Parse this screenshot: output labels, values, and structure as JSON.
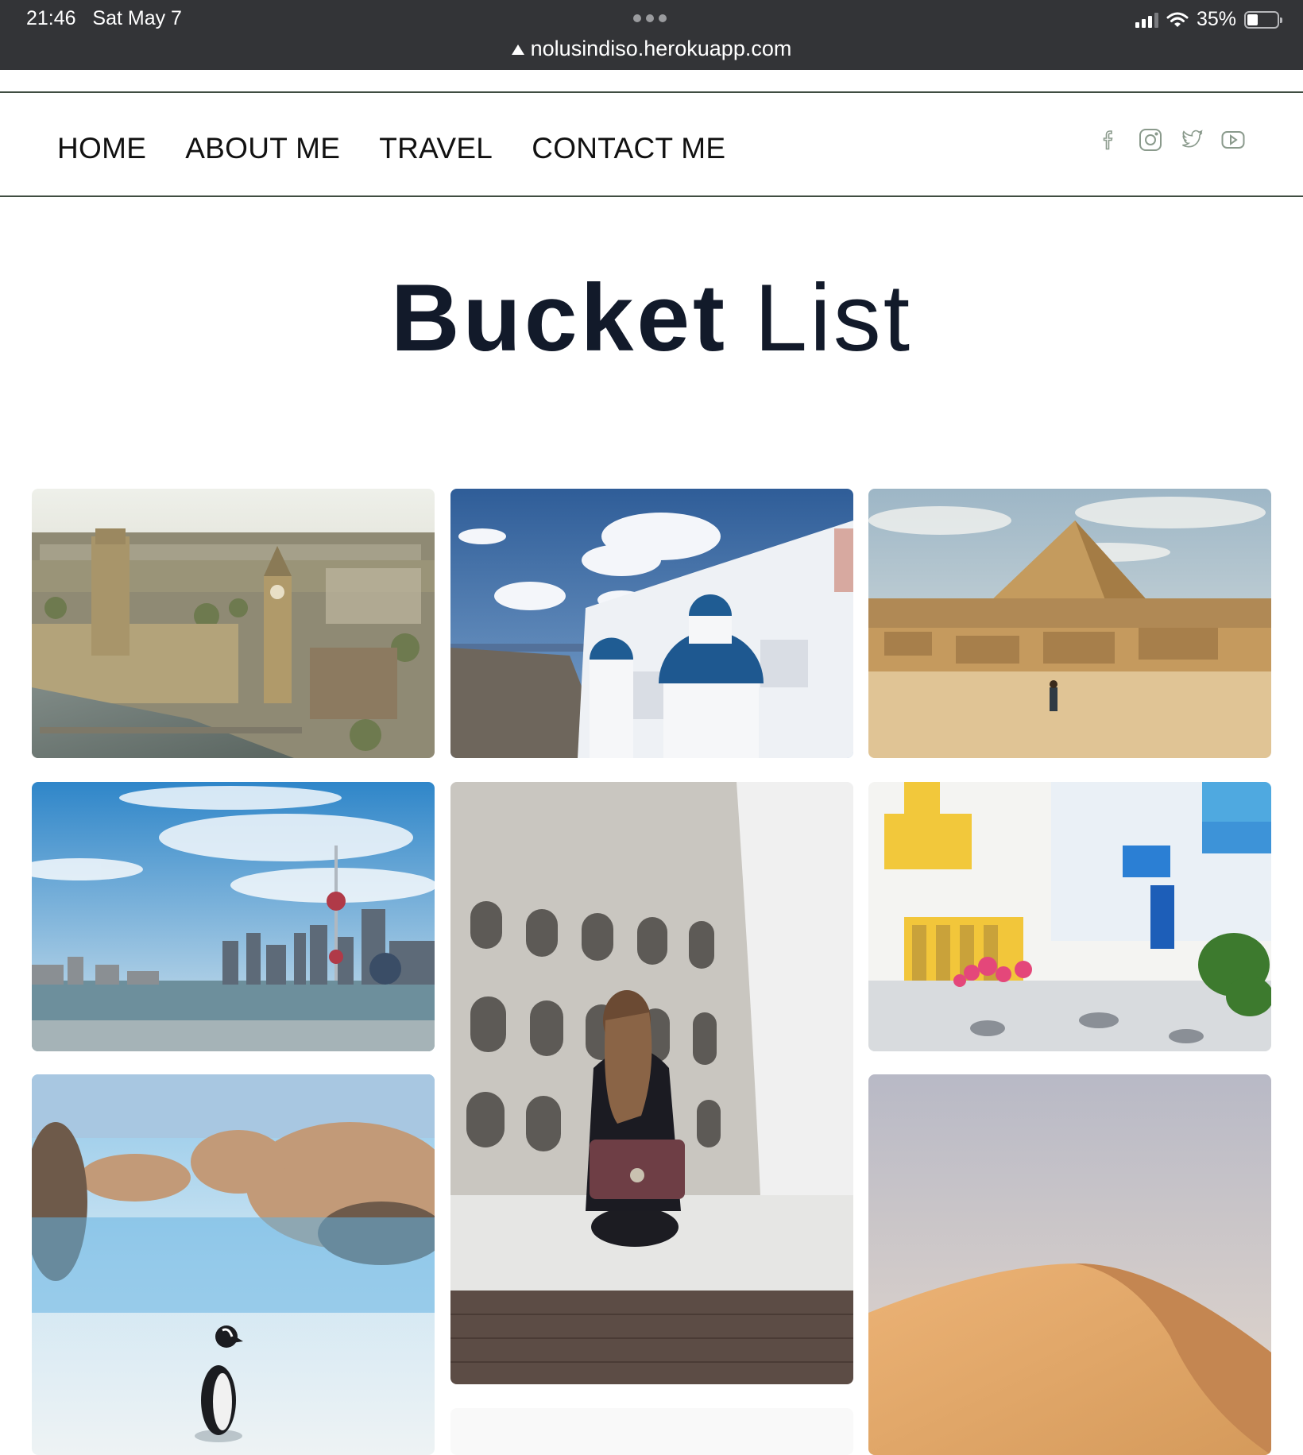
{
  "status_bar": {
    "time": "21:46",
    "date": "Sat May 7",
    "url": "nolusindiso.herokuapp.com",
    "battery": "35%",
    "battery_level": 0.35
  },
  "nav": {
    "items": [
      {
        "label": "HOME"
      },
      {
        "label": "ABOUT ME"
      },
      {
        "label": "TRAVEL"
      },
      {
        "label": "CONTACT ME"
      }
    ],
    "social_icons": [
      "facebook-icon",
      "instagram-icon",
      "twitter-icon",
      "youtube-icon"
    ]
  },
  "page": {
    "title_bold": "Bucket",
    "title_light": "List"
  },
  "gallery": {
    "photos": [
      {
        "name": "london-photo",
        "subject": "London skyline with Big Ben"
      },
      {
        "name": "santorini-photo",
        "subject": "Santorini blue domes"
      },
      {
        "name": "giza-photo",
        "subject": "Pyramid and Sphinx"
      },
      {
        "name": "shanghai-photo",
        "subject": "Shanghai skyline"
      },
      {
        "name": "colosseum-photo",
        "subject": "Colosseum with traveller"
      },
      {
        "name": "mykonos-street-photo",
        "subject": "Colourful Greek street"
      },
      {
        "name": "penguin-photo",
        "subject": "Penguin on beach"
      },
      {
        "name": "desert-photo",
        "subject": "Desert sand dune"
      }
    ]
  },
  "colors": {
    "status_bar_bg": "#333437",
    "nav_rule": "#3f4d41",
    "social_icon": "#8a9a8c",
    "title": "#121a2a"
  }
}
